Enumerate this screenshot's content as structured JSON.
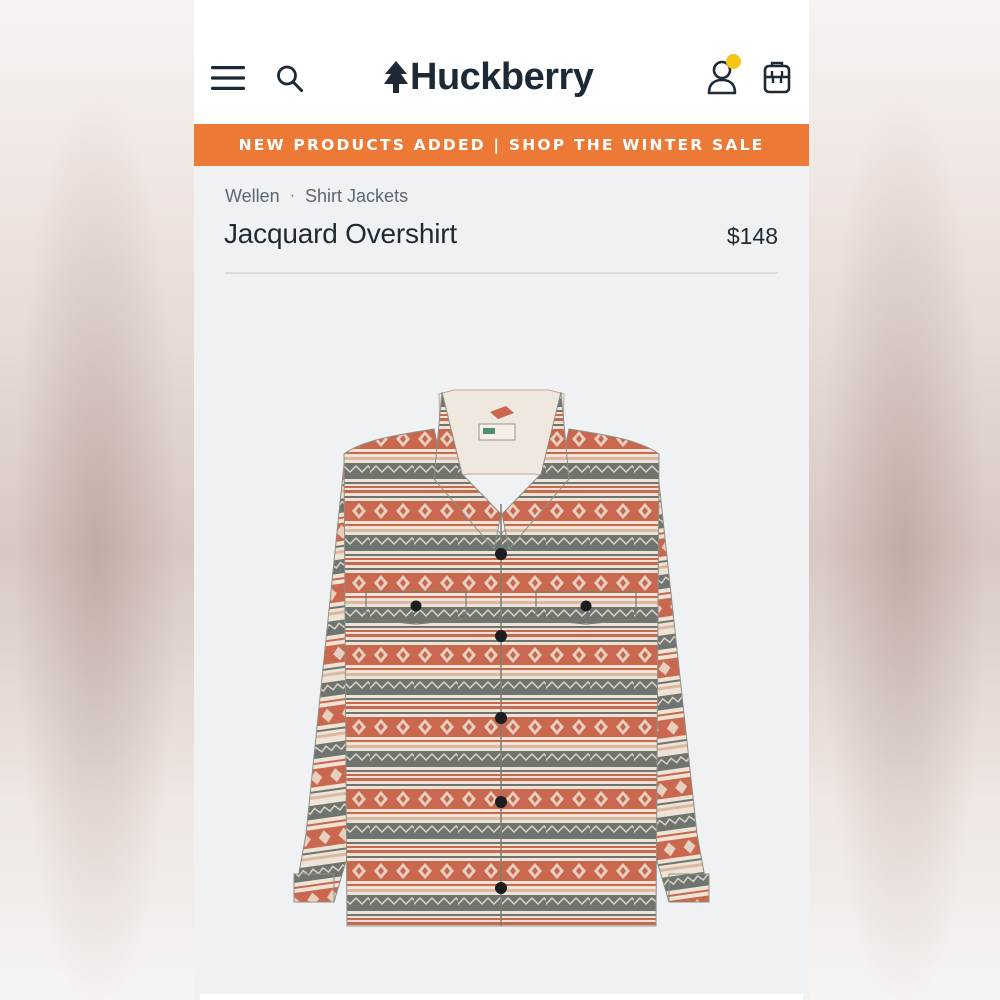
{
  "header": {
    "logo_text": "Huckberry",
    "menu_icon": "hamburger-menu-icon",
    "search_icon": "search-icon",
    "account_icon": "user-account-icon",
    "cart_icon": "backpack-cart-icon",
    "notification_dot_color": "#f5c518"
  },
  "banner": {
    "text": "NEW PRODUCTS ADDED | SHOP THE WINTER SALE",
    "color": "#ec7a36"
  },
  "breadcrumb": {
    "brand": "Wellen",
    "separator": "·",
    "category": "Shirt Jackets"
  },
  "product": {
    "title": "Jacquard Overshirt",
    "price": "$148",
    "image_subject": "patterned jacquard overshirt jacket",
    "colors": {
      "rust": "#c9684e",
      "slate": "#6e7470",
      "cream": "#eee3d4"
    }
  }
}
